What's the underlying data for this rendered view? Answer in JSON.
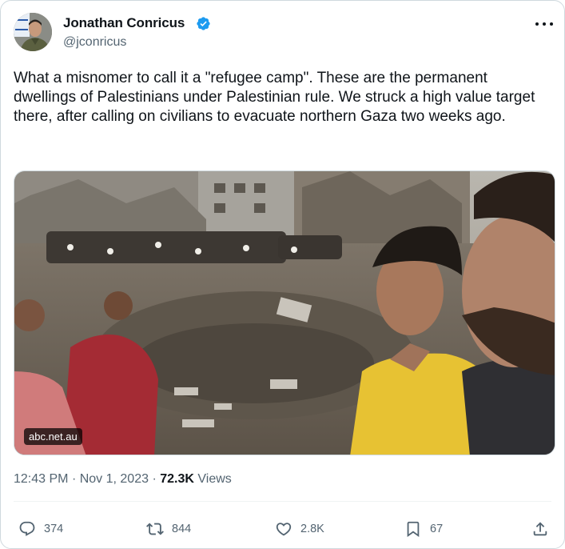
{
  "author": {
    "name": "Jonathan Conricus",
    "handle": "@jconricus",
    "verified": true
  },
  "tweet": {
    "text": "What a misnomer to call it a \"refugee camp\". These are the permanent dwellings of Palestinians under Palestinian rule. We struck a high value target there, after calling on civilians to evacuate northern Gaza two weeks ago.",
    "media_watermark": "abc.net.au",
    "time": "12:43 PM",
    "sep": "·",
    "date": "Nov 1, 2023",
    "views_count": "72.3K",
    "views_label": "Views"
  },
  "actions": {
    "replies": "374",
    "reposts": "844",
    "likes": "2.8K",
    "bookmarks": "67"
  },
  "icons": [
    "verified-badge-icon",
    "more-icon",
    "reply-icon",
    "repost-icon",
    "like-icon",
    "bookmark-icon",
    "share-icon"
  ],
  "colors": {
    "verified": "#1d9bf0",
    "secondary_text": "#536471",
    "primary_text": "#0f1419",
    "border": "#cfd9de"
  }
}
